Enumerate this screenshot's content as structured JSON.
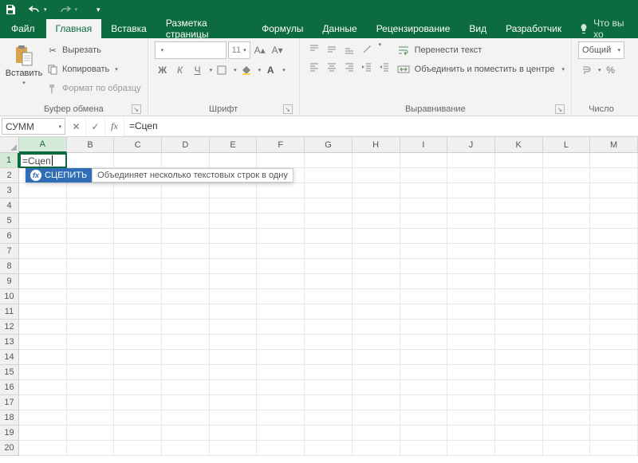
{
  "titlebar": {
    "items": [
      "save",
      "undo",
      "redo"
    ]
  },
  "tabs": {
    "file": "Файл",
    "home": "Главная",
    "insert": "Вставка",
    "layout": "Разметка страницы",
    "formulas": "Формулы",
    "data": "Данные",
    "review": "Рецензирование",
    "view": "Вид",
    "developer": "Разработчик",
    "tellme": "Что вы хо"
  },
  "ribbon": {
    "clipboard": {
      "paste": "Вставить",
      "cut": "Вырезать",
      "copy": "Копировать",
      "format_painter": "Формат по образцу",
      "label": "Буфер обмена"
    },
    "font": {
      "name_placeholder": "",
      "size": "11",
      "bold": "Ж",
      "italic": "К",
      "underline": "Ч",
      "label": "Шрифт"
    },
    "alignment": {
      "wrap": "Перенести текст",
      "merge": "Объединить и поместить в центре",
      "label": "Выравнивание"
    },
    "number": {
      "format": "Общий",
      "label": "Число"
    }
  },
  "formula_bar": {
    "name_box": "СУММ",
    "formula": "=Сцеп"
  },
  "grid": {
    "columns": [
      "A",
      "B",
      "C",
      "D",
      "E",
      "F",
      "G",
      "H",
      "I",
      "J",
      "K",
      "L",
      "M"
    ],
    "rows": [
      1,
      2,
      3,
      4,
      5,
      6,
      7,
      8,
      9,
      10,
      11,
      12,
      13,
      14,
      15,
      16,
      17,
      18,
      19,
      20
    ],
    "active_cell_value": "=Сцеп",
    "autocomplete": {
      "function": "СЦЕПИТЬ",
      "description": "Объединяет несколько текстовых строк в одну"
    }
  }
}
